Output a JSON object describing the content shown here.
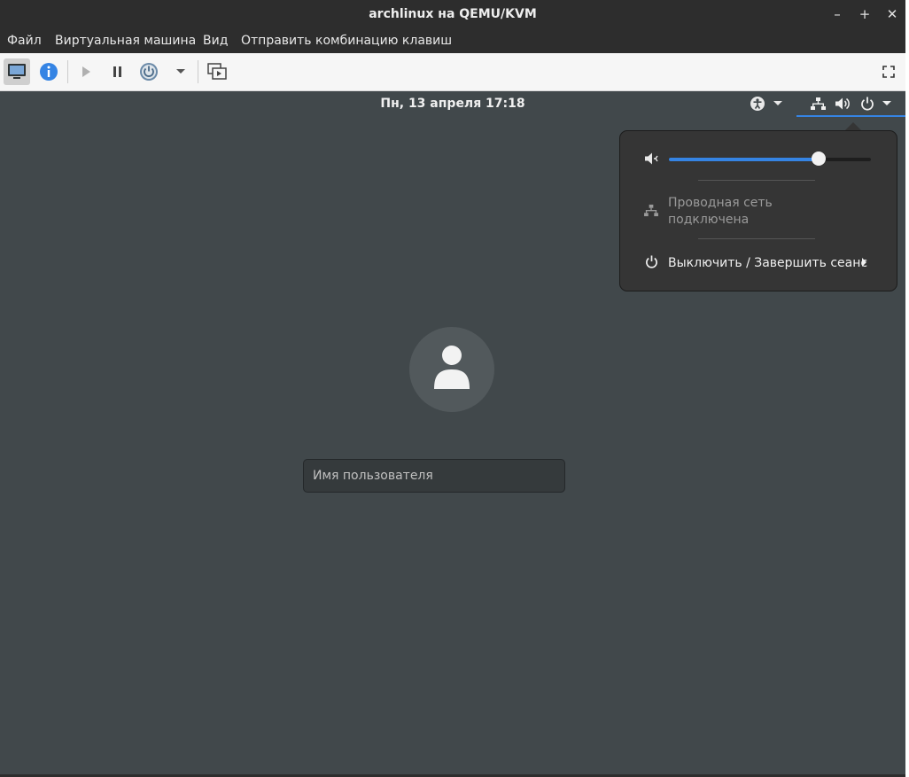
{
  "window": {
    "title": "archlinux на QEMU/KVM",
    "minimize_label": "–",
    "maximize_label": "+",
    "close_label": "✕"
  },
  "menubar": {
    "items": [
      "Файл",
      "Виртуальная машина",
      "Вид",
      "Отправить комбинацию клавиш"
    ]
  },
  "toolbar": {
    "buttons": [
      "console-icon",
      "info-icon",
      "play-icon",
      "pause-icon",
      "power-icon",
      "dropdown-icon",
      "snapshot-icon",
      "fullscreen-icon"
    ]
  },
  "guest": {
    "clock": "Пн, 13 апреля  17:18",
    "volume_percent": 74,
    "network_status": "Проводная сеть\nподключена",
    "power_menu_label": "Выключить / Завершить сеанс",
    "login_placeholder": "Имя пользователя"
  },
  "colors": {
    "accent": "#3584e4",
    "guest_background": "#41484b",
    "popover_background": "#353535"
  }
}
